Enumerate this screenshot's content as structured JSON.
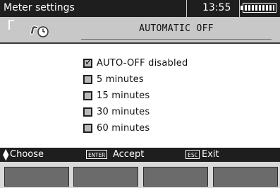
{
  "titlebar": {
    "title": "Meter settings",
    "time": "13:55",
    "battery_icon": "battery-icon"
  },
  "header": {
    "icon": "clock-power-icon",
    "title": "AUTOMATIC OFF"
  },
  "options": [
    {
      "label": "AUTO-OFF disabled",
      "checked": true
    },
    {
      "label": "5 minutes",
      "checked": false
    },
    {
      "label": "15 minutes",
      "checked": false
    },
    {
      "label": "30 minutes",
      "checked": false
    },
    {
      "label": "60 minutes",
      "checked": false
    }
  ],
  "helpbar": {
    "choose_label": "Choose",
    "enter_key": "ENTER",
    "accept_label": "Accept",
    "esc_key": "ESC",
    "exit_label": "Exit"
  },
  "colors": {
    "bar_dark": "#1e1e1e",
    "header_gray": "#c8c8c8",
    "fkey_gray": "#6b6b6b"
  }
}
